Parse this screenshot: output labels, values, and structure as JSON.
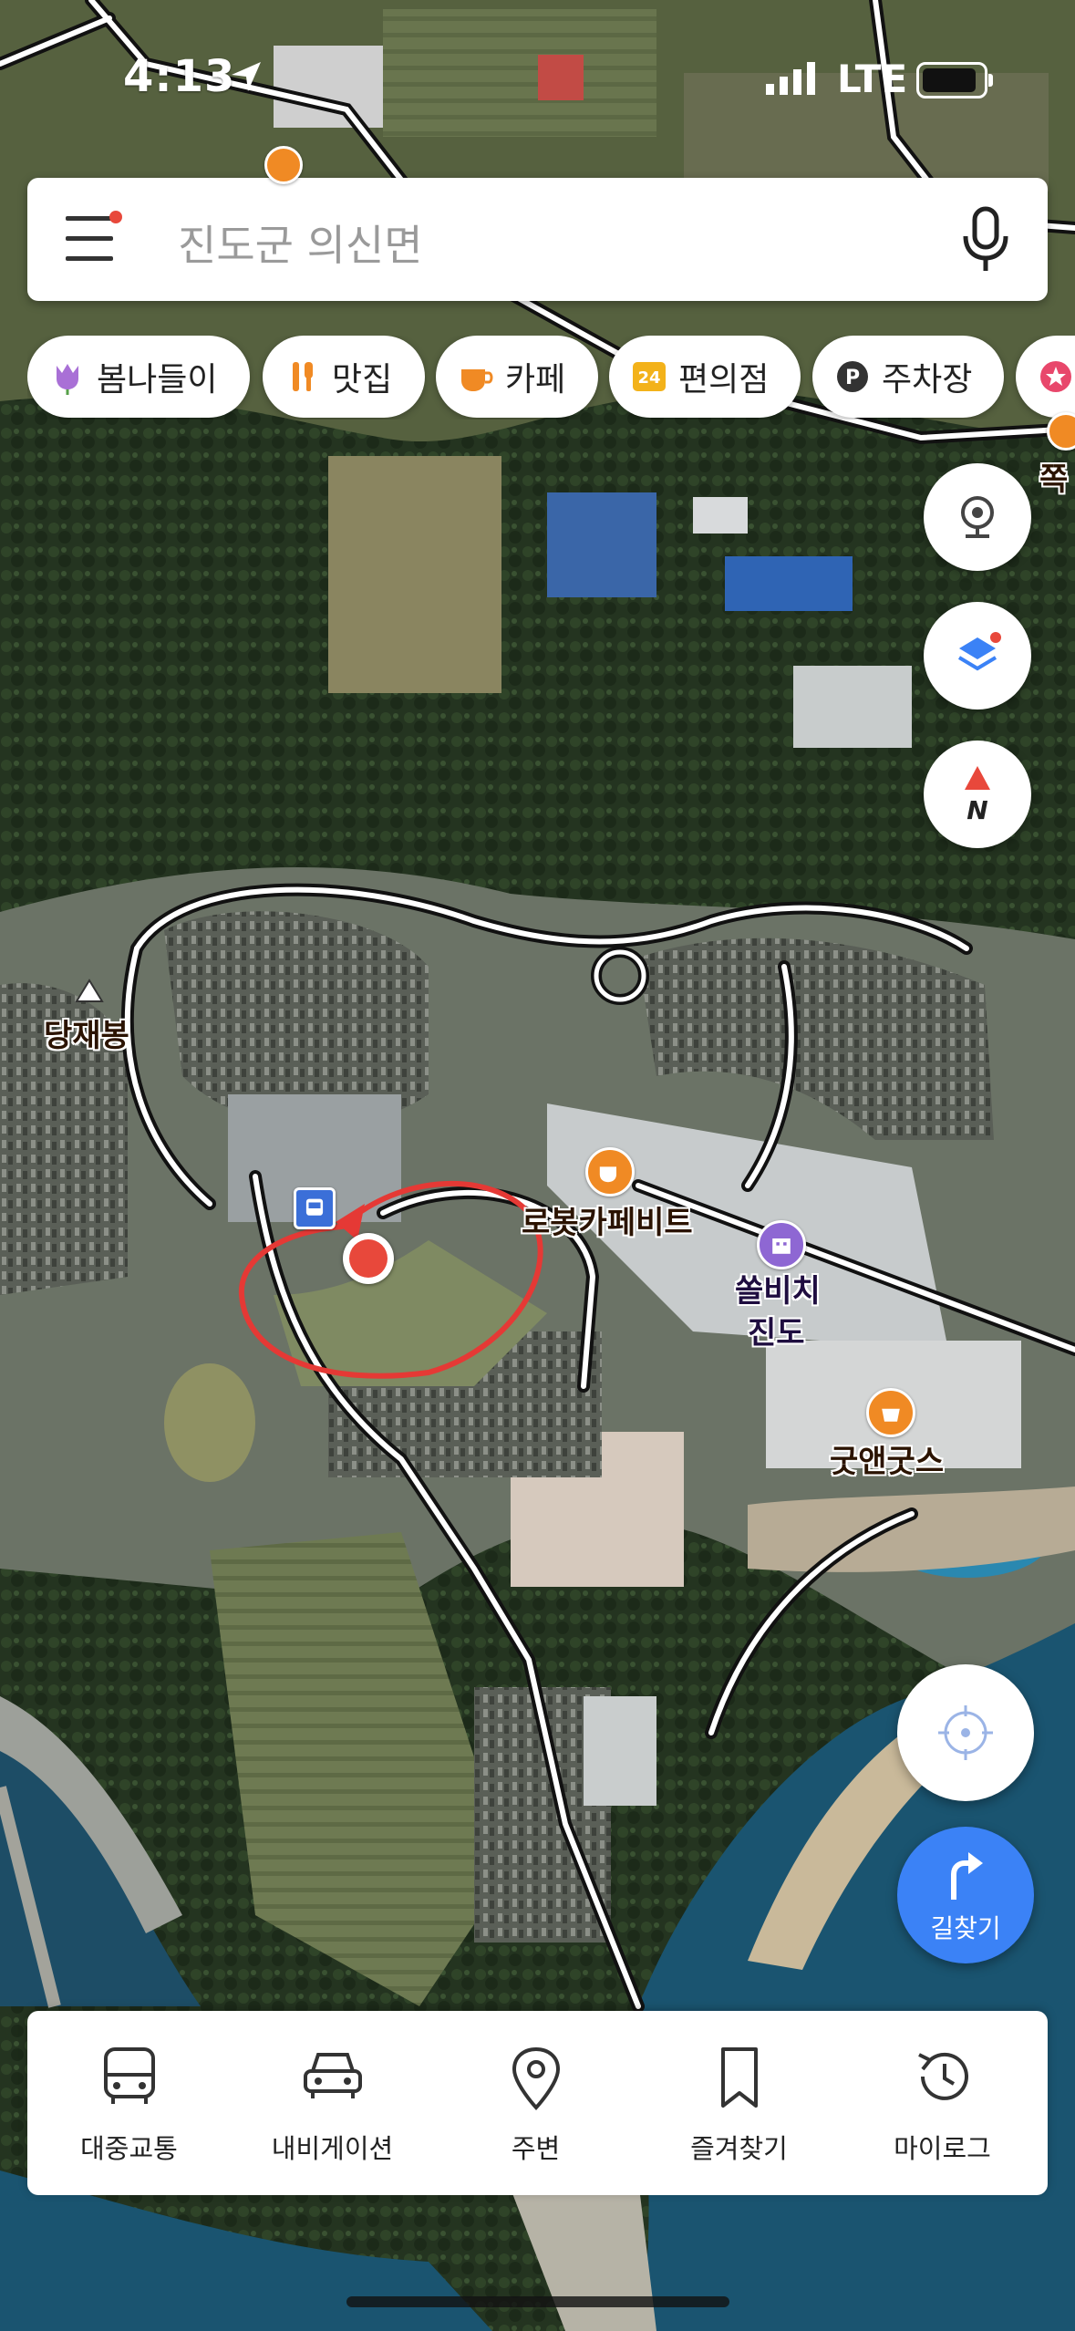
{
  "status_bar": {
    "time": "4:13",
    "network": "LTE"
  },
  "search": {
    "placeholder": "진도군 의신면"
  },
  "chips": [
    {
      "label": "봄나들이",
      "icon": "tulip-icon"
    },
    {
      "label": "맛집",
      "icon": "restaurant-icon"
    },
    {
      "label": "카페",
      "icon": "coffee-cup-icon"
    },
    {
      "label": "편의점",
      "icon": "convenience-store-24-icon"
    },
    {
      "label": "주차장",
      "icon": "parking-icon"
    }
  ],
  "map": {
    "labels": {
      "peak": "당재봉",
      "cafe": "로봇카페비트",
      "resort_line1": "쏠비치",
      "resort_line2": "진도",
      "store": "굿앤굿스",
      "edge_label": "쪽"
    }
  },
  "controls": {
    "route_label": "길찾기",
    "compass_letter": "N"
  },
  "bottom_nav": [
    {
      "label": "대중교통",
      "icon": "bus-icon"
    },
    {
      "label": "내비게이션",
      "icon": "car-icon"
    },
    {
      "label": "주변",
      "icon": "location-pin-icon"
    },
    {
      "label": "즐겨찾기",
      "icon": "bookmark-icon"
    },
    {
      "label": "마이로그",
      "icon": "history-icon"
    }
  ],
  "colors": {
    "accent": "#3b82f6",
    "marker": "#e8483b",
    "annotation": "#e53935"
  }
}
